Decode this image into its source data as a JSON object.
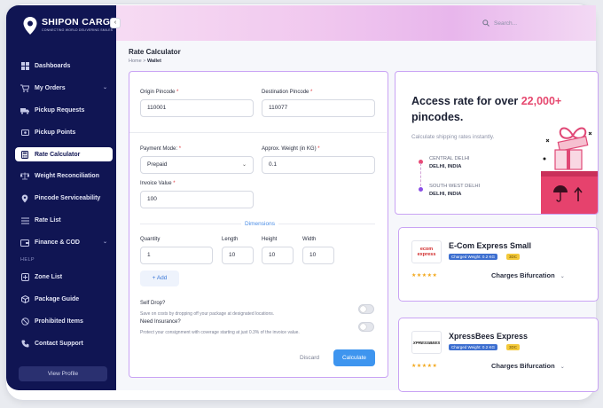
{
  "app": {
    "brand": "SHIPON CARGO",
    "tagline": "CONNECTING WORLD DELIVERING SMILES"
  },
  "colors": {
    "sidebar_bg": "#101553",
    "accent_blue": "#3e95ef",
    "accent_pink": "#e6476e",
    "card_border": "#c9a3f4"
  },
  "sidebar": {
    "collapse_icon": "chevron-left-icon",
    "items": [
      {
        "label": "Dashboards",
        "icon": "grid-icon",
        "expandable": false
      },
      {
        "label": "My Orders",
        "icon": "cart-icon",
        "expandable": true
      },
      {
        "label": "Pickup Requests",
        "icon": "truck-icon",
        "expandable": false
      },
      {
        "label": "Pickup Points",
        "icon": "map-pin-icon",
        "expandable": false
      },
      {
        "label": "Rate Calculator",
        "icon": "calculator-icon",
        "expandable": false,
        "active": true
      },
      {
        "label": "Weight Reconciliation",
        "icon": "scale-icon",
        "expandable": false
      },
      {
        "label": "Pincode Serviceability",
        "icon": "location-icon",
        "expandable": false
      },
      {
        "label": "Rate List",
        "icon": "list-icon",
        "expandable": false
      },
      {
        "label": "Finance & COD",
        "icon": "wallet-icon",
        "expandable": true
      }
    ],
    "help_heading": "HELP",
    "help_items": [
      {
        "label": "Zone List",
        "icon": "zone-icon"
      },
      {
        "label": "Package Guide",
        "icon": "package-icon"
      },
      {
        "label": "Prohibited Items",
        "icon": "ban-icon"
      },
      {
        "label": "Contact Support",
        "icon": "phone-icon"
      }
    ],
    "view_profile": "View Profile"
  },
  "topbar": {
    "search_placeholder": "Search..."
  },
  "page": {
    "title": "Rate Calculator",
    "breadcrumb_home": "Home",
    "breadcrumb_sep": ">",
    "breadcrumb_current": "Wallet"
  },
  "form": {
    "origin_label": "Origin Pincode",
    "origin_value": "110001",
    "destination_label": "Destination Pincode",
    "destination_value": "110077",
    "payment_label": "Payment Mode:",
    "payment_value": "Prepaid",
    "weight_label": "Approx. Weight (in KG)",
    "weight_value": "0.1",
    "invoice_label": "Invoice Value",
    "invoice_value": "100",
    "required_mark": "*",
    "dimensions_label": "Dimensions",
    "quantity_label": "Quantity",
    "quantity_value": "1",
    "length_label": "Length",
    "length_value": "10",
    "height_label": "Height",
    "height_value": "10",
    "width_label": "Width",
    "width_value": "10",
    "add_label": "+ Add",
    "self_drop_label": "Self Drop?",
    "self_drop_hint": "Save on costs by dropping off your package at designated locations.",
    "insurance_label": "Need Insurance?",
    "insurance_hint": "Protect your consignment with coverage starting at just 0.3% of the invoice value.",
    "discard_label": "Discard",
    "calculate_label": "Calculate"
  },
  "promo": {
    "headline_pre": "Access rate for over ",
    "headline_highlight": "22,000+",
    "headline_post": "pincodes.",
    "subtext": "Calculate shipping rates instantly.",
    "from_area": "CENTRAL DELHI",
    "from_city": "DELHI, INDIA",
    "to_area": "SOUTH WEST DELHI",
    "to_city": "DELHI, INDIA"
  },
  "couriers": [
    {
      "name": "E-Com Express Small",
      "logo_text": "ecom express",
      "weight_badge": "Charged Weight: 0.2 KG",
      "tag": "3DC",
      "stars": "★★★★★",
      "charges_label": "Charges Bifurcation",
      "charges_icon": "chevron-down-icon"
    },
    {
      "name": "XpressBees Express",
      "logo_text": "XPRESSBEES",
      "weight_badge": "Charged Weight: 0.2 KG",
      "tag": "3DC",
      "stars": "★★★★★",
      "charges_label": "Charges Bifurcation",
      "charges_icon": "chevron-down-icon"
    }
  ]
}
